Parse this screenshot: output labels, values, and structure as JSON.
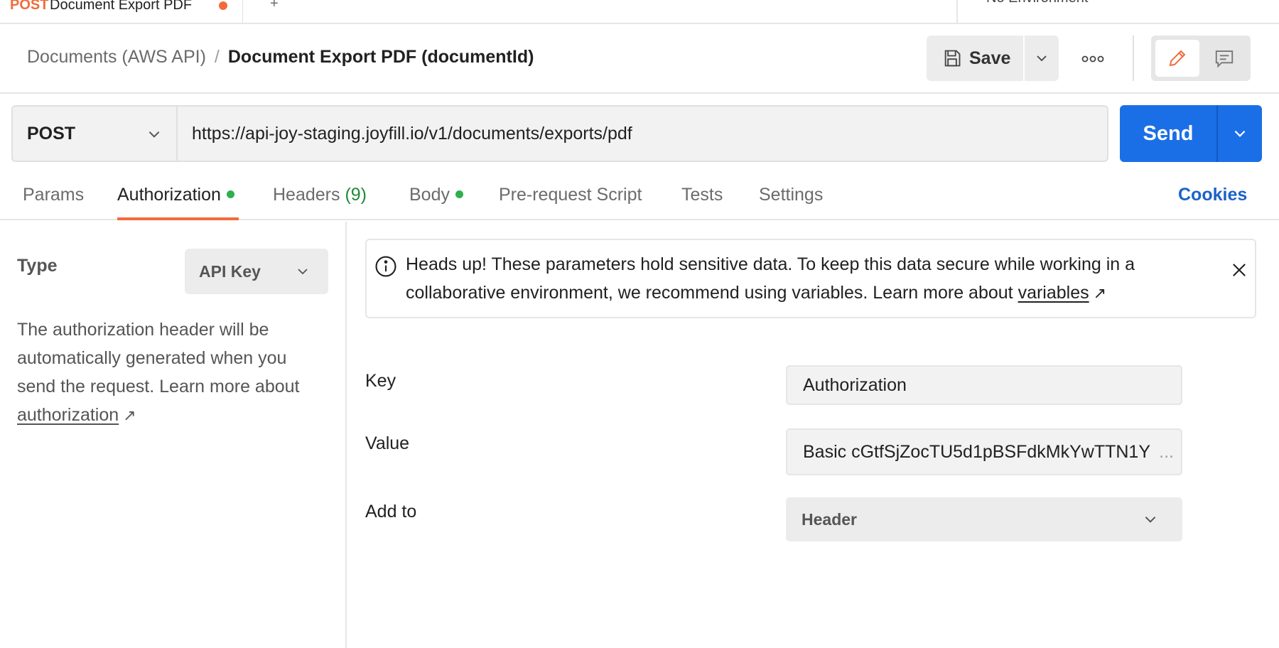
{
  "top_tabs": {
    "active": {
      "method": "POST",
      "title": "Document Export PDF"
    },
    "new_tab_symbol": "+",
    "environment": "No Environment"
  },
  "breadcrumb": {
    "parent": "Documents (AWS API)",
    "separator": "/",
    "current": "Document Export PDF (documentId)"
  },
  "toolbar": {
    "save_label": "Save"
  },
  "request": {
    "method": "POST",
    "url": "https://api-joy-staging.joyfill.io/v1/documents/exports/pdf",
    "send_label": "Send"
  },
  "tabs": {
    "params": "Params",
    "authorization": "Authorization",
    "headers": "Headers",
    "headers_count": "(9)",
    "body": "Body",
    "prerequest": "Pre-request Script",
    "tests": "Tests",
    "settings": "Settings",
    "cookies": "Cookies"
  },
  "auth": {
    "type_label": "Type",
    "type_value": "API Key",
    "help_text": "The authorization header will be automatically generated when you send the request. Learn more about ",
    "help_link": "authorization",
    "link_arrow": "↗"
  },
  "banner": {
    "text": "Heads up! These parameters hold sensitive data. To keep this data secure while working in a collaborative environment, we recommend using variables. Learn more about ",
    "link": "variables",
    "link_arrow": "↗"
  },
  "fields": {
    "key_label": "Key",
    "key_value": "Authorization",
    "value_label": "Value",
    "value_value": "Basic  cGtfSjZocTU5d1pBSFdkMkYwTTN1Y",
    "value_ellipsis": "...",
    "addto_label": "Add to",
    "addto_value": "Header"
  },
  "colors": {
    "accent_orange": "#f26b3a",
    "send_blue": "#1b6fe6",
    "cookies_blue": "#1b63c7",
    "status_green": "#2eb04b"
  }
}
